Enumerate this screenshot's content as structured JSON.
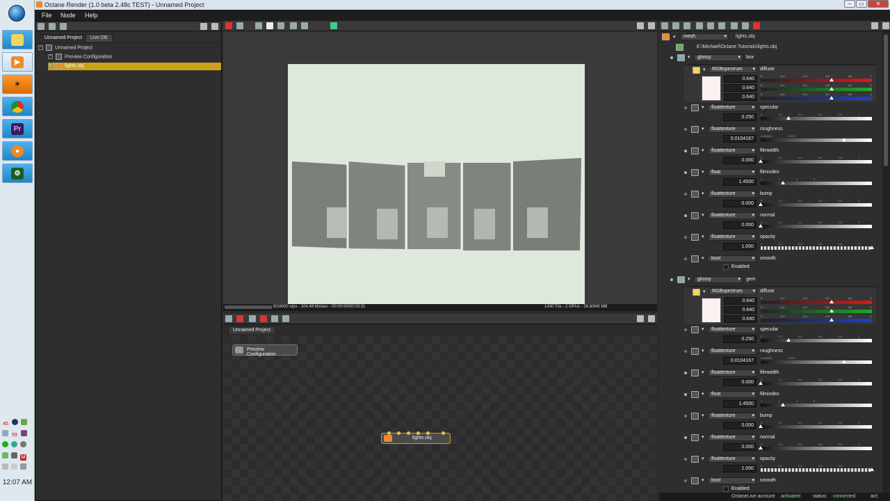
{
  "window": {
    "title": "Octane Render (1.0 beta 2.48c TEST) - Unnamed Project"
  },
  "menu": [
    "File",
    "Node",
    "Help"
  ],
  "taskbar": {
    "clock": "12:07 AM",
    "tray_numbers": [
      "45",
      "59"
    ]
  },
  "scene": {
    "tabs": [
      "Unnamed Project",
      "Live DB"
    ],
    "tree": [
      "Unnamed Project",
      "Preview Configuration",
      "lights.obj"
    ]
  },
  "viewport": {
    "status_left": "8/16000 s/px - 104.48 Ms/sec - 00:00:00/00:03:31",
    "status_right": "1430 Tris - 2 GPUs - 26.8/945 MB"
  },
  "graph": {
    "tab": "Unnamed Project",
    "nodes": [
      "Preview Configuration",
      "lights.obj"
    ]
  },
  "inspector": {
    "mesh_type": "mesh",
    "mesh_name": "lights.obj",
    "path": "E:\\Michael\\Octane Tutorials\\lights.obj",
    "materials": [
      {
        "type": "glossy",
        "name": "box",
        "diffuse": {
          "type": "RGBspectrum",
          "name": "diffuse",
          "values": [
            "0.640",
            "0.640",
            "0.640"
          ]
        },
        "params": [
          {
            "type": "floattexture",
            "name": "specular",
            "value": "0.250",
            "fraction": 0.25,
            "ticks": "0 0.2 0.4 0.6 0.8 1"
          },
          {
            "type": "floattexture",
            "name": "roughness",
            "value": "0.0104167",
            "fraction": 0.75,
            "ticks": "0.000001 0.001"
          },
          {
            "type": "floattexture",
            "name": "filmwidth",
            "value": "0.000",
            "fraction": 0,
            "ticks": "0 0.2 0.4 0.6 0.8 1"
          },
          {
            "type": "float",
            "name": "filmindex",
            "value": "1.4500",
            "fraction": 0.2,
            "ticks": "1 2 4 8"
          },
          {
            "type": "floattexture",
            "name": "bump",
            "value": "0.000",
            "fraction": 0,
            "ticks": "0 0.2 0.4 0.6 0.8 1"
          },
          {
            "type": "floattexture",
            "name": "normal",
            "value": "0.000",
            "fraction": 0,
            "ticks": "0 0.2 0.4 0.6 0.8 1"
          },
          {
            "type": "floattexture",
            "name": "opacity",
            "value": "1.000",
            "fraction": 1,
            "ticks": "0 0.2 0.4 0.6 0.8 1"
          }
        ],
        "bool": {
          "type": "bool",
          "name": "smooth",
          "label": "Enabled"
        }
      },
      {
        "type": "glossy",
        "name": "gem",
        "diffuse": {
          "type": "RGBspectrum",
          "name": "diffuse",
          "values": [
            "0.640",
            "0.640",
            "0.640"
          ]
        },
        "params": [
          {
            "type": "floattexture",
            "name": "specular",
            "value": "0.250",
            "fraction": 0.25,
            "ticks": "0 0.2 0.4 0.6 0.8 1"
          },
          {
            "type": "floattexture",
            "name": "roughness",
            "value": "0.0104167",
            "fraction": 0.75,
            "ticks": "0.000001 0.001"
          },
          {
            "type": "floattexture",
            "name": "filmwidth",
            "value": "0.000",
            "fraction": 0,
            "ticks": "0 0.2 0.4 0.6 0.8 1"
          },
          {
            "type": "float",
            "name": "filmindex",
            "value": "1.4500",
            "fraction": 0.2,
            "ticks": "1 2 4 8"
          },
          {
            "type": "floattexture",
            "name": "bump",
            "value": "0.000",
            "fraction": 0,
            "ticks": "0 0.2 0.4 0.6 0.8 1"
          },
          {
            "type": "floattexture",
            "name": "normal",
            "value": "0.000",
            "fraction": 0,
            "ticks": "0 0.2 0.4 0.6 0.8 1"
          },
          {
            "type": "floattexture",
            "name": "opacity",
            "value": "1.000",
            "fraction": 1,
            "ticks": "0 0.2 0.4 0.6 0.8 1"
          }
        ],
        "bool": {
          "type": "bool",
          "name": "smooth",
          "label": "Enabled"
        }
      }
    ]
  },
  "footer": {
    "account_label": "OctaneLive account:",
    "account_value": "activated",
    "status_label": "status:",
    "status_value": "connected",
    "act_label": "act:"
  }
}
